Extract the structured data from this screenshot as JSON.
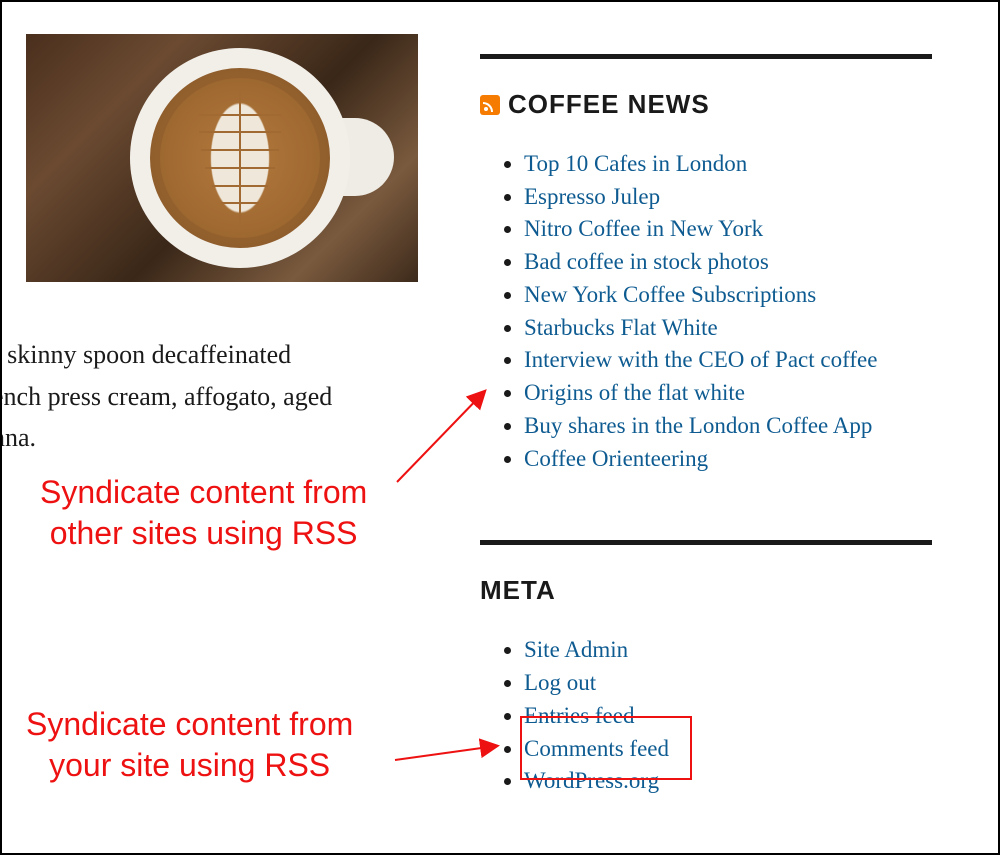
{
  "left": {
    "image_alt": "latte art coffee cup on wooden table",
    "paragraph_lines": [
      "r skinny spoon decaffeinated",
      "ench press cream, affogato, aged",
      "nna."
    ]
  },
  "sidebar": {
    "rss_widget": {
      "title": "COFFEE NEWS",
      "items": [
        "Top 10 Cafes in London",
        "Espresso Julep",
        "Nitro Coffee in New York",
        "Bad coffee in stock photos",
        "New York Coffee Subscriptions",
        "Starbucks Flat White",
        "Interview with the CEO of Pact coffee",
        "Origins of the flat white",
        "Buy shares in the London Coffee App",
        "Coffee Orienteering"
      ]
    },
    "meta_widget": {
      "title": "META",
      "items": [
        "Site Admin",
        "Log out",
        "Entries feed",
        "Comments feed",
        "WordPress.org"
      ]
    }
  },
  "annotations": {
    "top": "Syndicate content from\nother sites using RSS",
    "bottom": "Syndicate content from\nyour site using RSS"
  }
}
